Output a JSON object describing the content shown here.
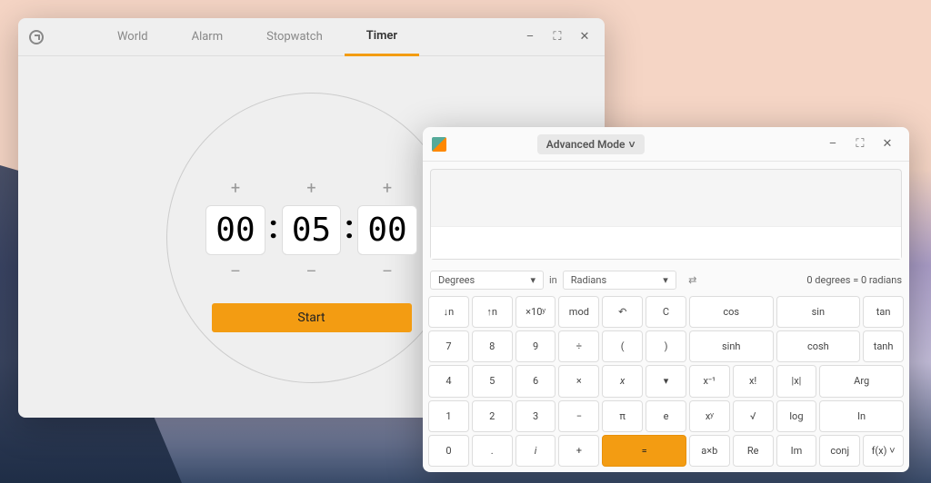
{
  "clocks": {
    "tabs": [
      "World",
      "Alarm",
      "Stopwatch",
      "Timer"
    ],
    "active_tab": "Timer",
    "timer": {
      "plus": [
        "+",
        "+",
        "+"
      ],
      "minus": [
        "–",
        "–",
        "–"
      ],
      "hh": "00",
      "mm": "05",
      "ss": "00",
      "colon": ":",
      "start_label": "Start"
    }
  },
  "calc": {
    "mode_label": "Advanced Mode",
    "angle": {
      "from": "Degrees",
      "in_label": "in",
      "to": "Radians",
      "result": "0 degrees  =  0 radians"
    },
    "buttons": [
      [
        "↓n",
        "↑n",
        "×10ʸ",
        "mod",
        "↶",
        "C",
        "cos",
        "sin",
        "tan"
      ],
      [
        "7",
        "8",
        "9",
        "÷",
        "(",
        ")",
        "sinh",
        "cosh",
        "tanh"
      ],
      [
        "4",
        "5",
        "6",
        "×",
        "x",
        "▾",
        "x⁻¹",
        "x!",
        "|x|",
        "Arg"
      ],
      [
        "1",
        "2",
        "3",
        "−",
        "π",
        "e",
        "xʸ",
        "√",
        "log",
        "ln"
      ],
      [
        "0",
        ".",
        "i",
        "+",
        "=",
        "a×b",
        "Re",
        "Im",
        "conj",
        "f(x) ˅"
      ]
    ]
  }
}
